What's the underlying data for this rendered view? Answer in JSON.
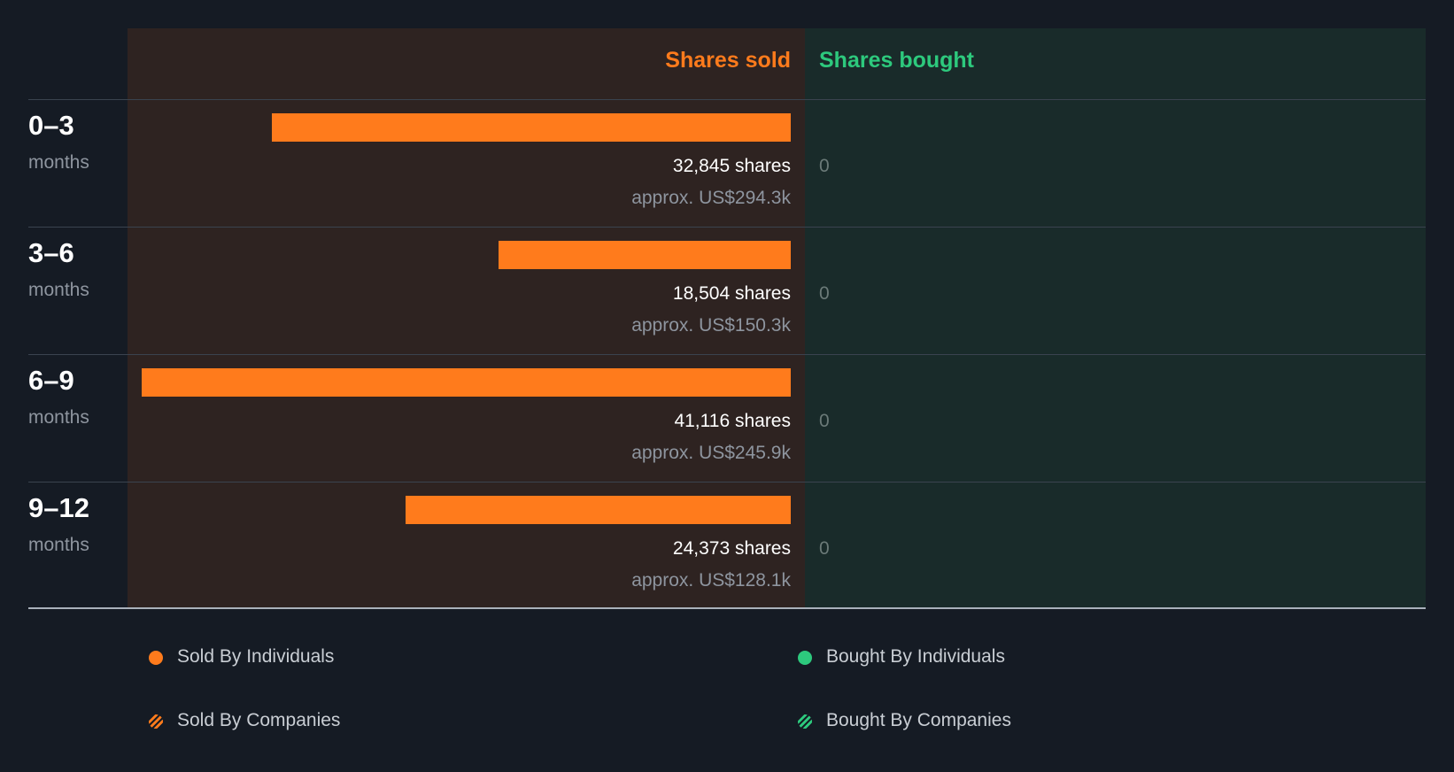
{
  "colors": {
    "sold": "#ff7b1c",
    "bought": "#2dc97d",
    "sold_bg": "#2e2321",
    "bought_bg": "#192b2a",
    "background": "#151b24"
  },
  "chart_data": {
    "type": "bar",
    "orientation": "horizontal",
    "headers": {
      "sold": "Shares sold",
      "bought": "Shares bought"
    },
    "categories": [
      {
        "period": "0–3",
        "unit": "months"
      },
      {
        "period": "3–6",
        "unit": "months"
      },
      {
        "period": "6–9",
        "unit": "months"
      },
      {
        "period": "9–12",
        "unit": "months"
      }
    ],
    "series": [
      {
        "name": "Sold By Individuals",
        "values": [
          32845,
          18504,
          41116,
          24373
        ]
      },
      {
        "name": "Bought By Individuals",
        "values": [
          0,
          0,
          0,
          0
        ]
      }
    ],
    "sold_labels": [
      "32,845 shares",
      "18,504 shares",
      "41,116 shares",
      "24,373 shares"
    ],
    "sold_approx": [
      "approx. US$294.3k",
      "approx. US$150.3k",
      "approx. US$245.9k",
      "approx. US$128.1k"
    ],
    "bought_labels": [
      "0",
      "0",
      "0",
      "0"
    ],
    "xlim": [
      0,
      41116
    ],
    "legend": [
      {
        "label": "Sold By Individuals",
        "color": "#ff7b1c",
        "style": "solid"
      },
      {
        "label": "Bought By Individuals",
        "color": "#2dc97d",
        "style": "solid"
      },
      {
        "label": "Sold By Companies",
        "color": "#ff7b1c",
        "style": "striped"
      },
      {
        "label": "Bought By Companies",
        "color": "#2dc97d",
        "style": "striped"
      }
    ]
  }
}
